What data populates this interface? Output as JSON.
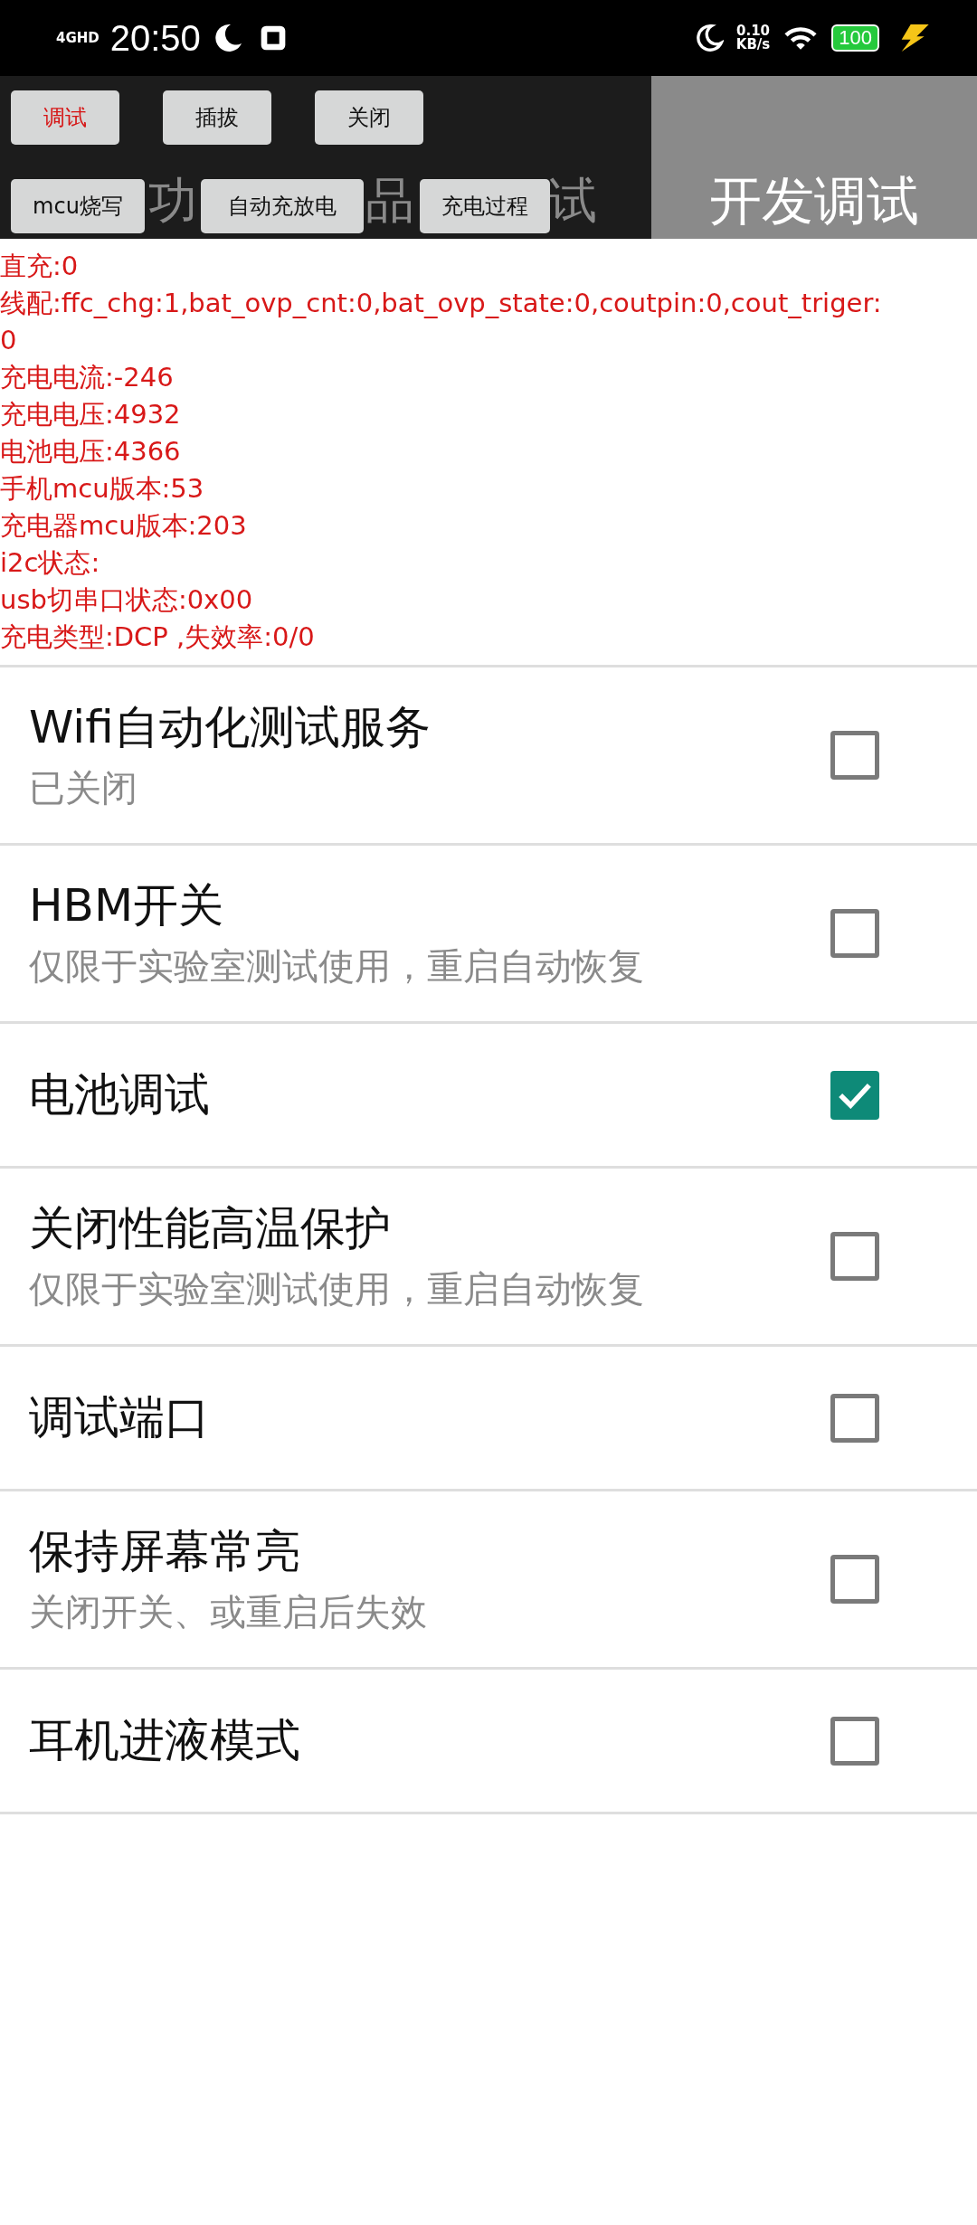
{
  "status_bar": {
    "network": "4GHD",
    "time": "20:50",
    "speed": "0.10",
    "speed_unit": "KB/s",
    "battery": "100"
  },
  "tabs": [
    {
      "fragments": [
        "功"
      ],
      "selected": false
    },
    {
      "fragments": [
        "品",
        "试"
      ],
      "selected": false
    },
    {
      "fragments": [
        "开发调试"
      ],
      "selected": true
    }
  ],
  "buttons": [
    {
      "label": "调试",
      "active": true
    },
    {
      "label": "插拔",
      "active": false
    },
    {
      "label": "关闭",
      "active": false
    },
    {
      "label": "mcu烧写",
      "active": false
    },
    {
      "label": "自动充放电",
      "active": false
    },
    {
      "label": "充电过程",
      "active": false
    }
  ],
  "debug_lines": [
    "直充:0",
    "线配:ffc_chg:1,bat_ovp_cnt:0,bat_ovp_state:0,coutpin:0,cout_triger:",
    "0",
    "充电电流:-246",
    "充电电压:4932",
    "电池电压:4366",
    "手机mcu版本:53",
    "充电器mcu版本:203",
    "i2c状态:",
    "usb切串口状态:0x00",
    "充电类型:DCP ,失效率:0/0"
  ],
  "settings": [
    {
      "title": "Wifi自动化测试服务",
      "subtitle": "已关闭",
      "checked": false
    },
    {
      "title": "HBM开关",
      "subtitle": "仅限于实验室测试使用，重启自动恢复",
      "checked": false
    },
    {
      "title": "电池调试",
      "checked": true
    },
    {
      "title": "关闭性能高温保护",
      "subtitle": "仅限于实验室测试使用，重启自动恢复",
      "checked": false
    },
    {
      "title": "调试端口",
      "checked": false
    },
    {
      "title": "保持屏幕常亮",
      "subtitle": "关闭开关、或重启后失效",
      "checked": false
    },
    {
      "title": "耳机进液模式",
      "checked": false
    }
  ]
}
